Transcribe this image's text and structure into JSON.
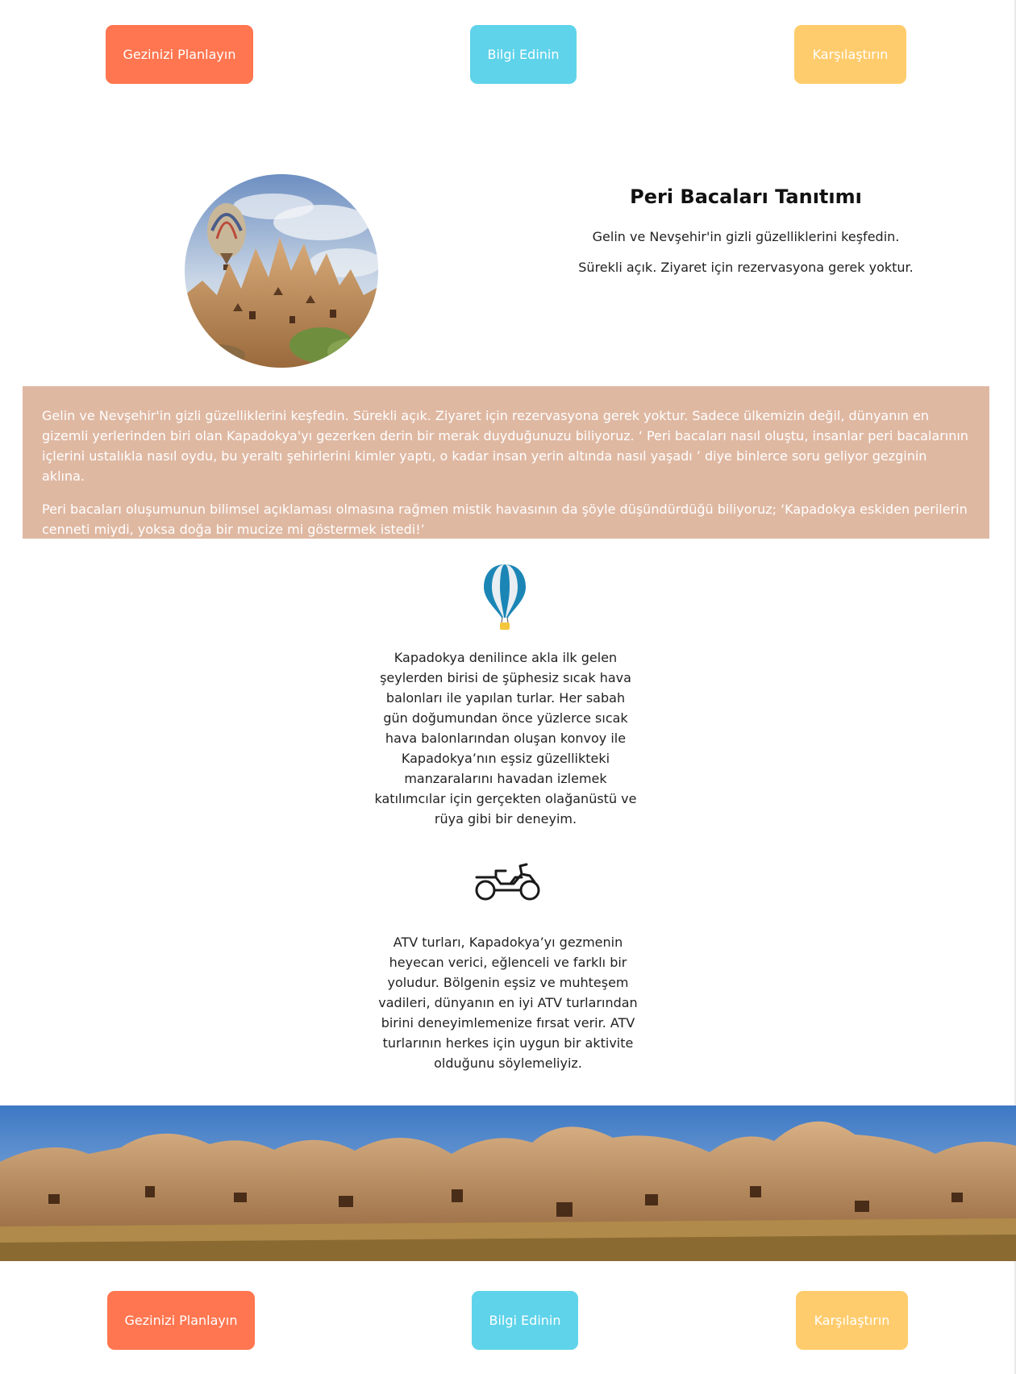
{
  "buttons": {
    "plan": "Gezinizi Planlayın",
    "info": "Bilgi Edinin",
    "compare": "Karşılaştırın"
  },
  "intro": {
    "title": "Peri Bacaları Tanıtımı",
    "line1": "Gelin ve Nevşehir'in gizli güzelliklerini keşfedin.",
    "line2": "Sürekli açık. Ziyaret için rezervasyona gerek yoktur."
  },
  "band": {
    "paragraph1": "Gelin ve Nevşehir'in gizli güzelliklerini keşfedin. Sürekli açık. Ziyaret için rezervasyona gerek yoktur. Sadece ülkemizin değil, dünyanın en gizemli yerlerinden biri olan Kapadokya'yı gezerken derin bir merak duyduğunuzu biliyoruz. ‘ Peri bacaları nasıl oluştu, insanlar peri bacalarının içlerini ustalıkla nasıl oydu, bu yeraltı şehirlerini kimler yaptı, o kadar insan yerin altında nasıl yaşadı ’ diye binlerce soru geliyor gezginin aklına.",
    "paragraph2": "Peri bacaları oluşumunun bilimsel açıklaması olmasına rağmen mistik havasının da şöyle düşündürdüğü biliyoruz; ‘Kapadokya eskiden perilerin cenneti miydi, yoksa doğa bir mucize mi göstermek istedi!’"
  },
  "features": {
    "balloon_icon": "hot-air-balloon-icon",
    "balloon_text": "Kapadokya denilince akla ilk gelen şeylerden birisi de şüphesiz sıcak hava balonları ile yapılan turlar. Her sabah gün doğumundan önce yüzlerce sıcak hava balonlarından oluşan konvoy ile Kapadokya’nın eşsiz güzellikteki manzaralarını havadan izlemek katılımcılar için gerçekten olağanüstü ve rüya gibi bir deneyim.",
    "atv_icon": "atv-motorbike-icon",
    "atv_text": "ATV turları, Kapadokya’yı gezmenin heyecan verici, eğlenceli ve farklı bir yoludur. Bölgenin eşsiz ve muhteşem vadileri, dünyanın en iyi ATV turlarından birini deneyimlemenize fırsat verir. ATV turlarının herkes için uygun bir aktivite olduğunu söylemeliyiz."
  },
  "colors": {
    "plan_button": "#ff7650",
    "info_button": "#5ed3ea",
    "compare_button": "#ffcc6d",
    "band_background": "#dfb8a2"
  }
}
